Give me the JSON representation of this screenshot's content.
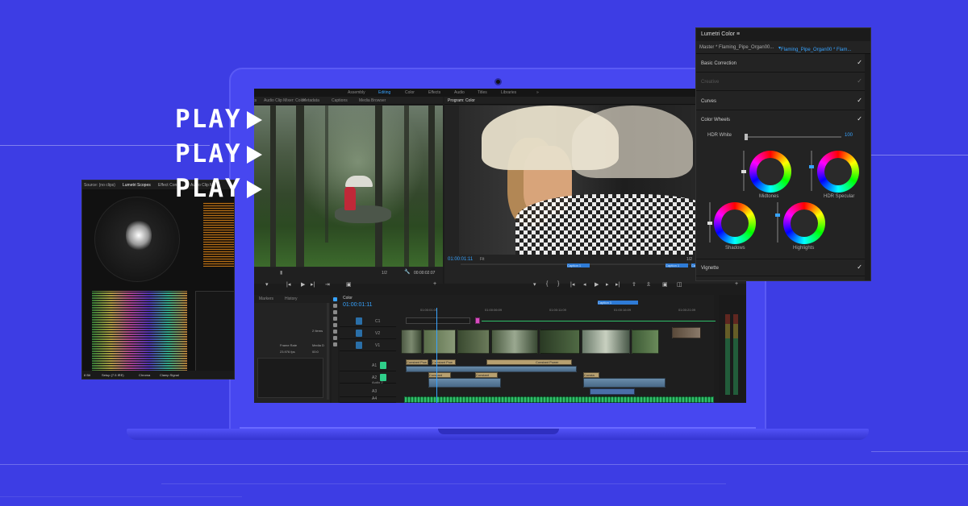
{
  "play_text": [
    "PLAY",
    "PLAY",
    "PLAY"
  ],
  "workspace_tabs": [
    {
      "label": "Assembly",
      "active": false
    },
    {
      "label": "Editing",
      "active": true
    },
    {
      "label": "Color",
      "active": false
    },
    {
      "label": "Effects",
      "active": false
    },
    {
      "label": "Audio",
      "active": false
    },
    {
      "label": "Titles",
      "active": false
    },
    {
      "label": "Libraries",
      "active": false
    }
  ],
  "source_panel": {
    "tabs": [
      "ects",
      "Audio Clip Mixer: Color",
      "Metadata",
      "Captions",
      "Media Browser"
    ],
    "zoom": "1/2",
    "timecode": "00:00:02:07"
  },
  "program_panel": {
    "title": "Program: Color",
    "timecode": "01:00:01:11",
    "fit": "Fit",
    "zoom": "1/2",
    "markers": [
      "Caption 1",
      "Caption 1",
      "Caption 2"
    ]
  },
  "project_panel": {
    "tabs": [
      "Markers",
      "History"
    ],
    "items_count": "2 Items",
    "frame_rate_label": "Frame Rate",
    "frame_rate_value": "23.976 fps",
    "media_label": "Media D",
    "media_value": "00:0"
  },
  "timeline": {
    "tab": "Color",
    "timecode": "01:00:01:11",
    "ruler": [
      "01:00:01:09",
      "01:00:06:09",
      "01:00:11:09",
      "01:00:16:09",
      "01:00:21:09"
    ],
    "caption_marker": "Caption 1",
    "tracks": [
      {
        "id": "C1",
        "kind": "caption"
      },
      {
        "id": "V2",
        "kind": "video"
      },
      {
        "id": "V1",
        "kind": "video"
      },
      {
        "id": "A1",
        "kind": "audio"
      },
      {
        "id": "A2",
        "kind": "audio",
        "name": "Audio 2"
      },
      {
        "id": "A3",
        "kind": "audio"
      },
      {
        "id": "A4",
        "kind": "audio"
      }
    ],
    "fx_clips": [
      "Constant Pow",
      "Constant Pow",
      "Constant Power",
      "Constant",
      "Constant",
      "Consta"
    ]
  },
  "scopes": {
    "tabs": [
      "Source: (no clips)",
      "Lumetri Scopes",
      "Effect Contr",
      "Audio Clip Mi"
    ],
    "bottom_bar": [
      "8 Bit",
      "Setup (7.5 IRE)",
      "Chroma",
      "Clamp Signal"
    ]
  },
  "lumetri": {
    "title": "Lumetri Color",
    "master_label": "Master * Flaming_Pipe_Organ00...",
    "clip_label": "Flaming_Pipe_Organ00 * Flam...",
    "sections": [
      {
        "label": "Basic Correction",
        "checked": true,
        "dim": false
      },
      {
        "label": "Creative",
        "checked": true,
        "dim": true
      },
      {
        "label": "Curves",
        "checked": true,
        "dim": false
      },
      {
        "label": "Color Wheels",
        "checked": true,
        "dim": false
      }
    ],
    "hdr_label": "HDR White",
    "hdr_value": "100",
    "wheels": [
      "Midtones",
      "HDR Specular",
      "Shadows",
      "Highlights"
    ],
    "vignette_label": "Vignette",
    "checkmark": "✓"
  },
  "colors": {
    "background": "#3d3de4",
    "accent_blue": "#37a3ff",
    "laptop": "#4747f0"
  }
}
